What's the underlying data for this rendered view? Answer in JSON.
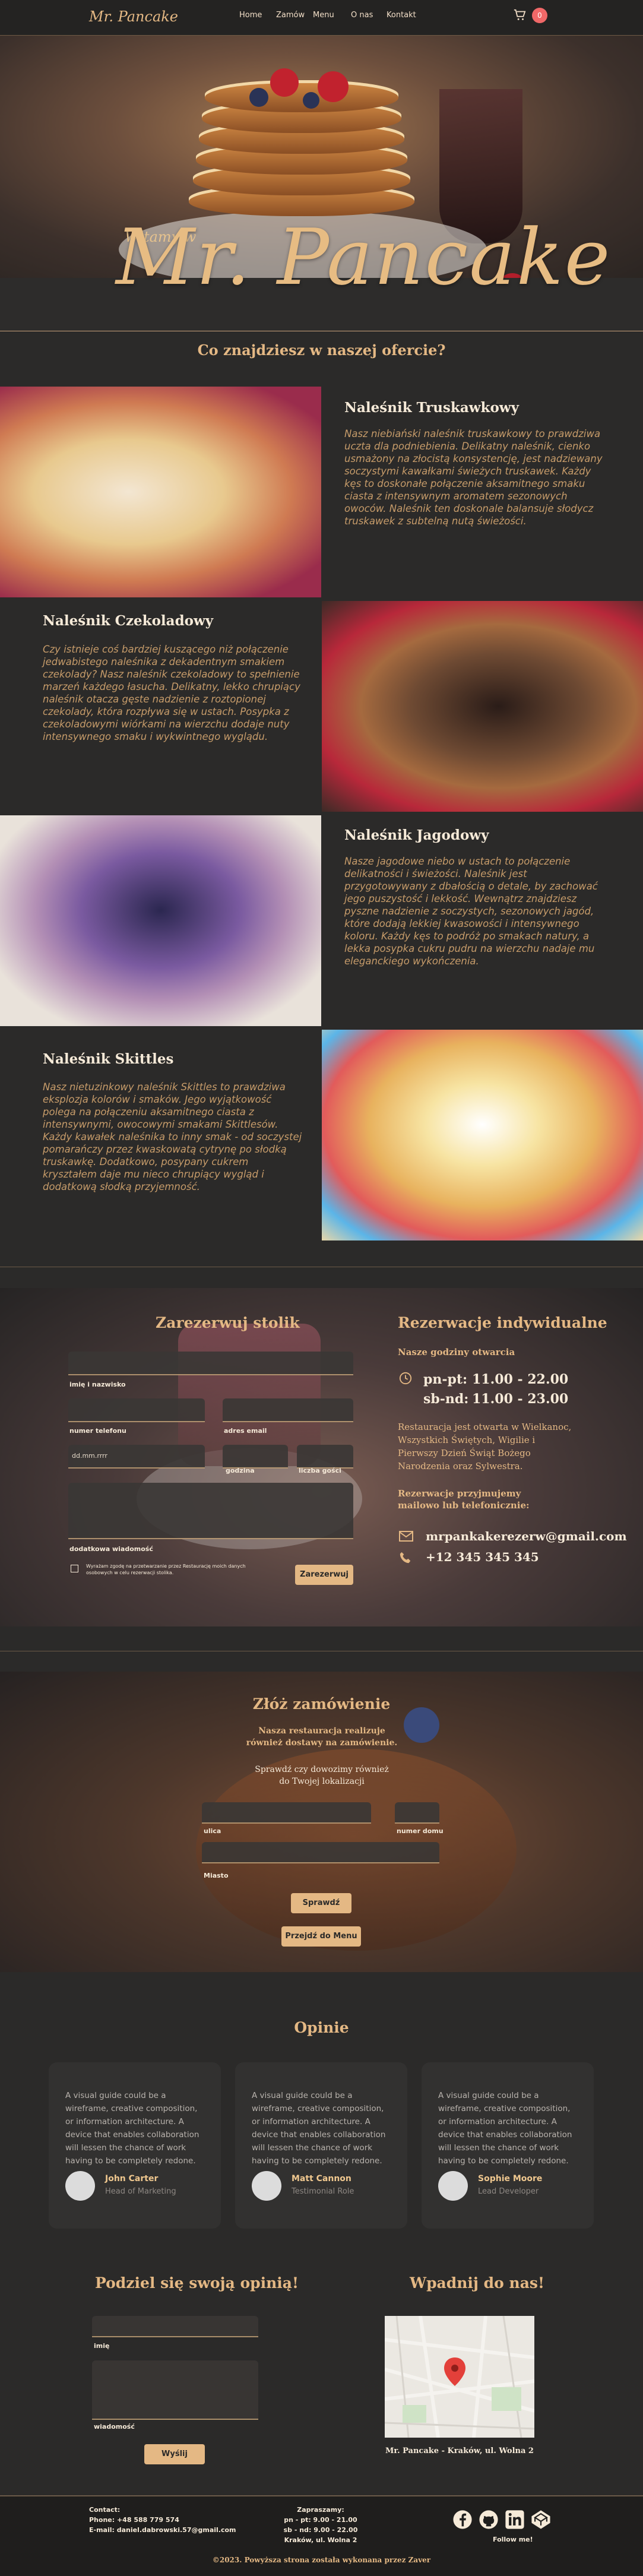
{
  "nav": {
    "logo": "Mr. Pancake",
    "links": [
      "Home",
      "Zamów",
      "Menu",
      "O nas",
      "Kontakt"
    ],
    "cart_count": "0"
  },
  "hero": {
    "welcome": "Witamy w",
    "title": "Mr. Pancake"
  },
  "offer": {
    "title": "Co znajdziesz w naszej ofercie?",
    "items": [
      {
        "name": "Naleśnik Truskawkowy",
        "text": "Nasz niebiański naleśnik truskawkowy to prawdziwa uczta dla podniebienia. Delikatny naleśnik, cienko usmażony na złocistą konsystencję, jest nadziewany soczystymi kawałkami świeżych truskawek. Każdy kęs to doskonałe połączenie aksamitnego smaku ciasta z intensywnym aromatem sezonowych owoców. Naleśnik ten doskonale balansuje słodycz truskawek z subtelną nutą świeżości."
      },
      {
        "name": "Naleśnik Czekoladowy",
        "text": "Czy istnieje coś bardziej kuszącego niż połączenie jedwabistego naleśnika z dekadentnym smakiem czekolady? Nasz naleśnik czekoladowy to spełnienie marzeń każdego łasucha. Delikatny, lekko chrupiący naleśnik otacza gęste nadzienie z roztopionej czekolady, która rozpływa się w ustach. Posypka z czekoladowymi wiórkami na wierzchu dodaje nuty intensywnego smaku i wykwintnego wyglądu."
      },
      {
        "name": "Naleśnik Jagodowy",
        "text": "Nasze jagodowe niebo w ustach to połączenie delikatności i świeżości. Naleśnik jest przygotowywany z dbałością o detale, by zachować jego puszystość i lekkość. Wewnątrz znajdziesz pyszne nadzienie z soczystych, sezonowych jagód, które dodają lekkiej kwasowości i intensywnego koloru. Każdy kęs to podróż po smakach natury, a lekka posypka cukru pudru na wierzchu nadaje mu eleganckiego wykończenia."
      },
      {
        "name": "Naleśnik Skittles",
        "text": "Nasz nietuzinkowy naleśnik Skittles to prawdziwa eksplozja kolorów i smaków. Jego wyjątkowość polega na połączeniu aksamitnego ciasta z intensywnymi, owocowymi smakami Skittlesów. Każdy kawałek naleśnika to inny smak - od soczystej pomarańczy przez kwaskowatą cytrynę po słodką truskawkę. Dodatkowo, posypany cukrem kryształem daje mu nieco chrupiący wygląd i dodatkową słodką przyjemność."
      }
    ]
  },
  "reservation": {
    "title": "Zarezerwuj stolik",
    "labels": {
      "name": "imię i nazwisko",
      "phone": "numer telefonu",
      "email": "adres email",
      "date": "godzina",
      "time": "liczba gości",
      "message": "dodatkowa wiadomość"
    },
    "placeholders": {
      "date": "dd.mm.rrrr"
    },
    "consent": "Wyrażam zgodę na przetwarzanie przez Restaurację moich danych osobowych w celu rezerwacji stolika.",
    "button": "Zarezerwuj",
    "individual_title": "Rezerwacje indywidualne",
    "hours_title": "Nasze godziny otwarcia",
    "hours": [
      {
        "days": "pn-pt:",
        "time": "11.00 - 22.00"
      },
      {
        "days": "sb-nd:",
        "time": "11.00 - 23.00"
      }
    ],
    "note": "Restauracja jest otwarta w Wielkanoc, Wszystkich Świętych, Wigilie i Pierwszy Dzień Świąt Bożego Narodzenia oraz Sylwestra.",
    "contact_intro": "Rezerwacje przyjmujemy mailowo lub telefonicznie:",
    "email": "mrpankakerezerw@gmail.com",
    "phone": "+12 345 345 345"
  },
  "order": {
    "title": "Złóż zamówienie",
    "sub": "Nasza restauracja realizuje również dostawy na zamówienie.",
    "check": "Sprawdź czy dowozimy również do Twojej lokalizacji",
    "labels": {
      "street": "ulica",
      "number": "numer domu",
      "city": "Miasto"
    },
    "check_button": "Sprawdź",
    "menu_button": "Przejdź do Menu"
  },
  "opinions": {
    "title": "Opinie",
    "cards": [
      {
        "text": "A visual guide could be a wireframe, creative composition, or information architecture. A device that enables collaboration will lessen the chance of work having to be completely redone.",
        "name": "John Carter",
        "role": "Head of Marketing"
      },
      {
        "text": "A visual guide could be a wireframe, creative composition, or information architecture. A device that enables collaboration will lessen the chance of work having to be completely redone.",
        "name": "Matt Cannon",
        "role": "Testimonial Role"
      },
      {
        "text": "A visual guide could be a wireframe, creative composition, or information architecture. A device that enables collaboration will lessen the chance of work having to be completely redone.",
        "name": "Sophie Moore",
        "role": "Lead Developer"
      }
    ]
  },
  "share": {
    "title": "Podziel się swoją opinią!",
    "name_label": "imię",
    "msg_label": "wiadomość",
    "button": "Wyślij"
  },
  "visit": {
    "title": "Wpadnij do nas!",
    "address": "Mr. Pancake - Kraków, ul. Wolna 2"
  },
  "footer": {
    "contact_title": "Contact:",
    "phone": "Phone: +48 588 779 574",
    "email": "E-mail: daniel.dabrowski.57@gmail.com",
    "invite_title": "Zapraszamy:",
    "hours1": "pn - pt: 9.00 - 21.00",
    "hours2": "sb - nd: 9.00 - 22.00",
    "address": "Kraków, ul. Wolna 2",
    "follow": "Follow me!",
    "copyright": "©2023. Powyższa strona została wykonana przez Zaver"
  },
  "colors": {
    "accent": "#e4b884",
    "bg": "#2b2a29",
    "text_light": "#f6ead8",
    "badge": "#f06868"
  }
}
